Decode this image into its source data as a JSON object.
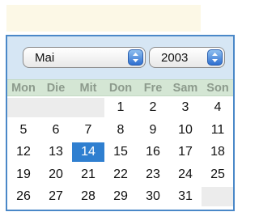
{
  "date_field": {
    "value": ""
  },
  "calendar": {
    "month_select": {
      "value": "Mai"
    },
    "year_select": {
      "value": "2003"
    },
    "weekdays": [
      "Mon",
      "Die",
      "Mit",
      "Don",
      "Fre",
      "Sam",
      "Son"
    ],
    "weeks": [
      [
        "",
        "",
        "",
        "1",
        "2",
        "3",
        "4"
      ],
      [
        "5",
        "6",
        "7",
        "8",
        "9",
        "10",
        "11"
      ],
      [
        "12",
        "13",
        "14",
        "15",
        "16",
        "17",
        "18"
      ],
      [
        "19",
        "20",
        "21",
        "22",
        "23",
        "24",
        "25"
      ],
      [
        "26",
        "27",
        "28",
        "29",
        "30",
        "31",
        ""
      ]
    ],
    "selected_day": "14",
    "colors": {
      "accent": "#2f7fd0",
      "header_bg": "#d6e6f4",
      "weekday_bg": "#d4e6d4",
      "empty_cell": "#ececec",
      "input_bg": "#fcf8e6"
    }
  }
}
